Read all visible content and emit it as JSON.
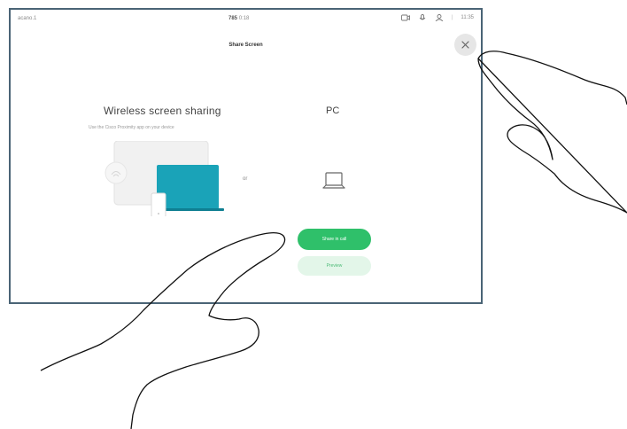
{
  "status_bar": {
    "left_text": "acano.1",
    "center_bold": "785",
    "center_light": "0:18",
    "right_time": "11:35"
  },
  "title": "Share Screen",
  "wireless": {
    "heading": "Wireless screen sharing",
    "subtitle": "Use the Cisco Proximity app on your device"
  },
  "or_label": "or",
  "pc": {
    "heading": "PC"
  },
  "buttons": {
    "share_in_call": "Share in call",
    "preview": "Preview"
  },
  "icons": {
    "close": "close-icon",
    "camera": "camera-icon",
    "mic": "microphone-icon",
    "person": "person-icon",
    "laptop": "laptop-icon"
  },
  "colors": {
    "accent_green": "#2fc06a",
    "preview_green_bg": "#e3f6e9",
    "device_teal": "#1aa3b8",
    "frame_border": "#4a6476"
  }
}
